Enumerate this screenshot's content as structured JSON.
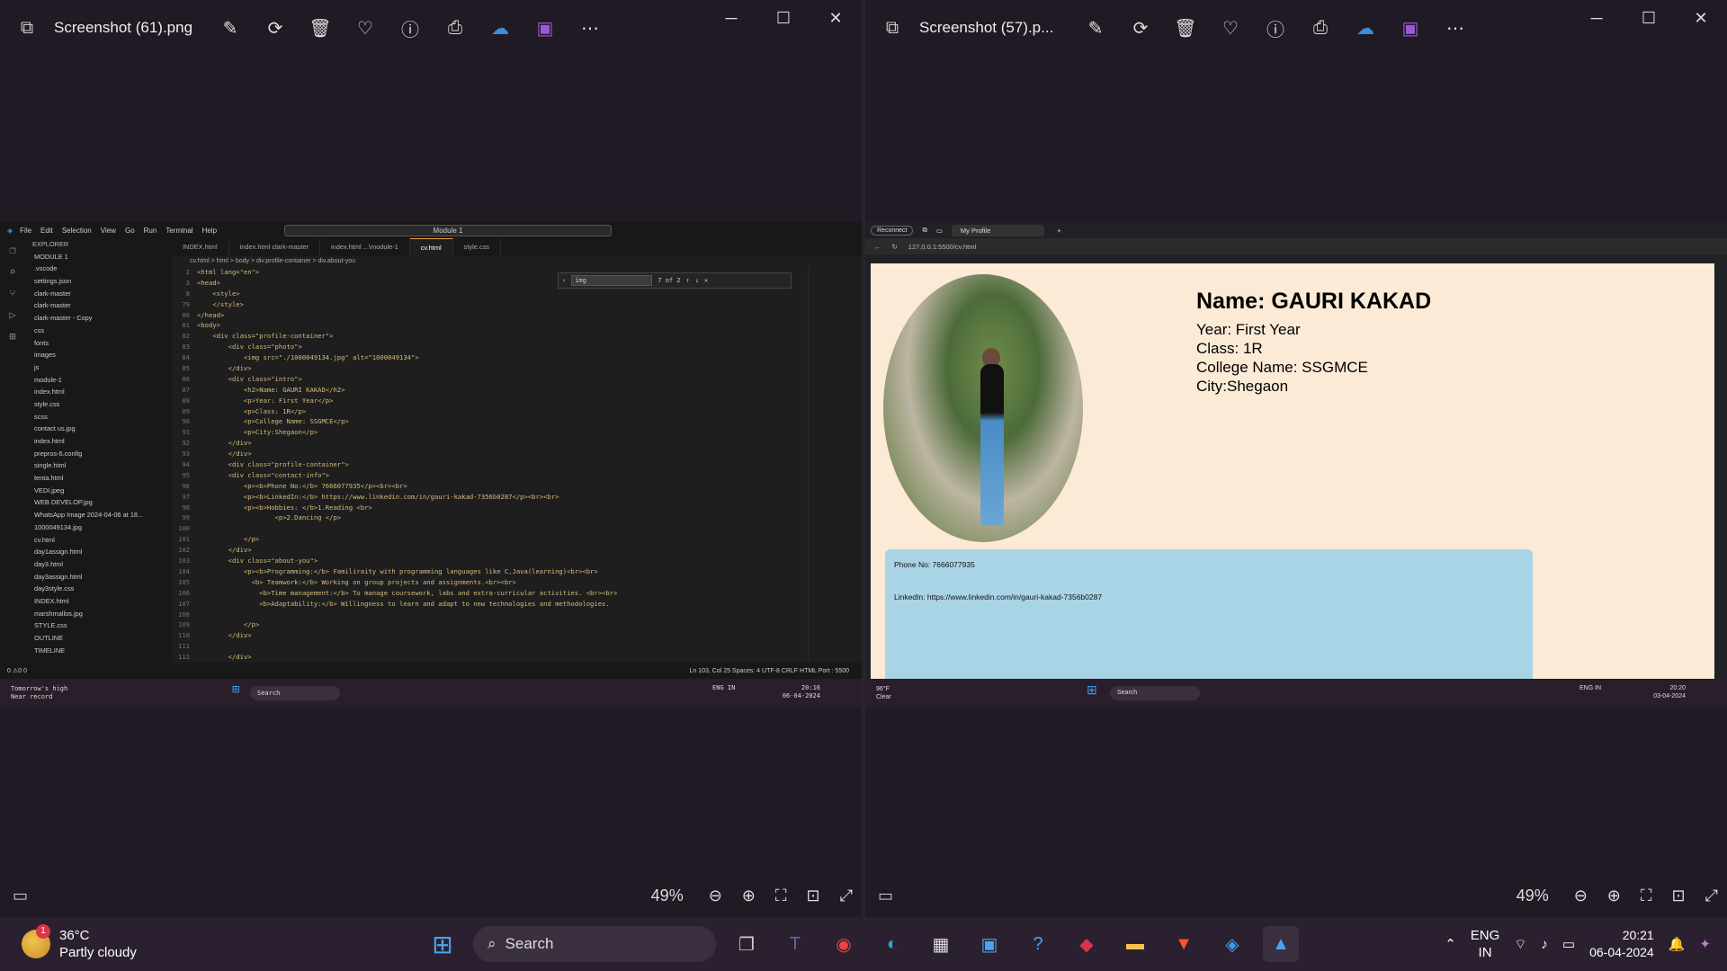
{
  "left_viewer": {
    "filename": "Screenshot (61).png",
    "zoom": "49%",
    "vscode": {
      "menu": [
        "File",
        "Edit",
        "Selection",
        "View",
        "Go",
        "Run",
        "Terminal",
        "Help"
      ],
      "search": "Module 1",
      "explorer_title": "EXPLORER",
      "explorer_items": [
        "MODULE 1",
        ".vscode",
        "settings.json",
        "clark-master",
        "clark-master",
        "clark-master - Copy",
        "css",
        "fonts",
        "images",
        "js",
        "module-1",
        "index.html",
        "style.css",
        "scss",
        "contact us.jpg",
        "index.html",
        "prepros-6.config",
        "single.html",
        "tenta.html",
        "VEDI.jpeg",
        "WEB DEVELOP.jpg",
        "WhatsApp Image 2024-04-06 at 18...",
        "1000049134.jpg",
        "cv.html",
        "day1assign.html",
        "day3.html",
        "day3assign.html",
        "day3style.css",
        "INDEX.html",
        "marshmallos.jpg",
        "STYLE.css",
        "OUTLINE",
        "TIMELINE"
      ],
      "tabs": [
        "INDEX.html",
        "index.html clark-master",
        "index.html ...\\module-1",
        "cv.html",
        "style.css"
      ],
      "breadcrumb": "cv.html > html > body > div.profile-container > div.about-you",
      "find_query": "img",
      "find_count": "7 of 2",
      "code": [
        {
          "no": "2",
          "t": "<html lang=\"en\">"
        },
        {
          "no": "3",
          "t": "<head>"
        },
        {
          "no": "8",
          "t": "    <style>"
        },
        {
          "no": "79",
          "t": "    </style>"
        },
        {
          "no": "80",
          "t": "</head>"
        },
        {
          "no": "81",
          "t": "<body>"
        },
        {
          "no": "82",
          "t": "    <div class=\"profile-container\">"
        },
        {
          "no": "83",
          "t": "        <div class=\"photo\">"
        },
        {
          "no": "84",
          "t": "            <img src=\"./1000049134.jpg\" alt=\"1000049134\">"
        },
        {
          "no": "85",
          "t": "        </div>"
        },
        {
          "no": "86",
          "t": "        <div class=\"intro\">"
        },
        {
          "no": "87",
          "t": "            <h2>Name: GAURI KAKAD</h2>"
        },
        {
          "no": "88",
          "t": "            <p>Year: First Year</p>"
        },
        {
          "no": "89",
          "t": "            <p>Class: 1R</p>"
        },
        {
          "no": "90",
          "t": "            <p>College Name: SSGMCE</p>"
        },
        {
          "no": "91",
          "t": "            <p>City:Shegaon</p>"
        },
        {
          "no": "92",
          "t": "        </div>"
        },
        {
          "no": "93",
          "t": "        </div>"
        },
        {
          "no": "94",
          "t": "        <div class=\"profile-container\">"
        },
        {
          "no": "95",
          "t": "        <div class=\"contact-info\">"
        },
        {
          "no": "96",
          "t": "            <p><b>Phone No:</b> 7666077935</p><br><br>"
        },
        {
          "no": "97",
          "t": "            <p><b>LinkedIn:</b> https://www.linkedin.com/in/gauri-kakad-7356b0287</p><br><br>"
        },
        {
          "no": "98",
          "t": "            <p><b>Hobbies: </b>1.Reading <br>"
        },
        {
          "no": "99",
          "t": "                    <p>2.Dancing </p>"
        },
        {
          "no": "100",
          "t": ""
        },
        {
          "no": "101",
          "t": "            </p>"
        },
        {
          "no": "102",
          "t": "        </div>"
        },
        {
          "no": "103",
          "t": "        <div class=\"about-you\">"
        },
        {
          "no": "104",
          "t": "            <p><b>Programming:</b> Familiraity with programming languages like C,Java(learning)<br><br>"
        },
        {
          "no": "105",
          "t": "              <b> Teamwork:</b> Working on group projects and assignments.<br><br>"
        },
        {
          "no": "106",
          "t": "                <b>Time management:</b> To manage coursework, labs and extra-curricular activities. <br><br>"
        },
        {
          "no": "107",
          "t": "                <b>Adaptability:</b> Willingness to learn and adapt to new technologies and methodologies."
        },
        {
          "no": "108",
          "t": ""
        },
        {
          "no": "109",
          "t": "            </p>"
        },
        {
          "no": "110",
          "t": "        </div>"
        },
        {
          "no": "111",
          "t": ""
        },
        {
          "no": "112",
          "t": "        </div>"
        }
      ],
      "status": "Ln 103, Col 25   Spaces: 4   UTF-8   CRLF   HTML   Port : 5500",
      "status_left": "0 ⚠0   0",
      "taskbar_weather": "Tomorrow's high",
      "taskbar_weather2": "Near record",
      "taskbar_search": "Search",
      "taskbar_lang": "ENG IN",
      "taskbar_time": "20:16",
      "taskbar_date": "06-04-2024"
    }
  },
  "right_viewer": {
    "filename": "Screenshot (57).p...",
    "zoom": "49%",
    "browser": {
      "reconnect": "Reconnect",
      "tab_title": "My Profile",
      "url": "127.0.0.1:5500/cv.html",
      "name": "Name: GAURI KAKAD",
      "year": "Year: First Year",
      "class": "Class: 1R",
      "college": "College Name: SSGMCE",
      "city": "City:Shegaon",
      "phone": "Phone No: 7666077935",
      "linkedin": "LinkedIn: https://www.linkedin.com/in/gauri-kakad-7356b0287",
      "taskbar_weather": "96°F",
      "taskbar_weather2": "Clear",
      "taskbar_search": "Search",
      "taskbar_lang": "ENG IN",
      "taskbar_time": "20:20",
      "taskbar_date": "03-04-2024"
    }
  },
  "taskbar": {
    "temp": "36°C",
    "condition": "Partly cloudy",
    "badge": "1",
    "search": "Search",
    "lang1": "ENG",
    "lang2": "IN",
    "time": "20:21",
    "date": "06-04-2024"
  }
}
